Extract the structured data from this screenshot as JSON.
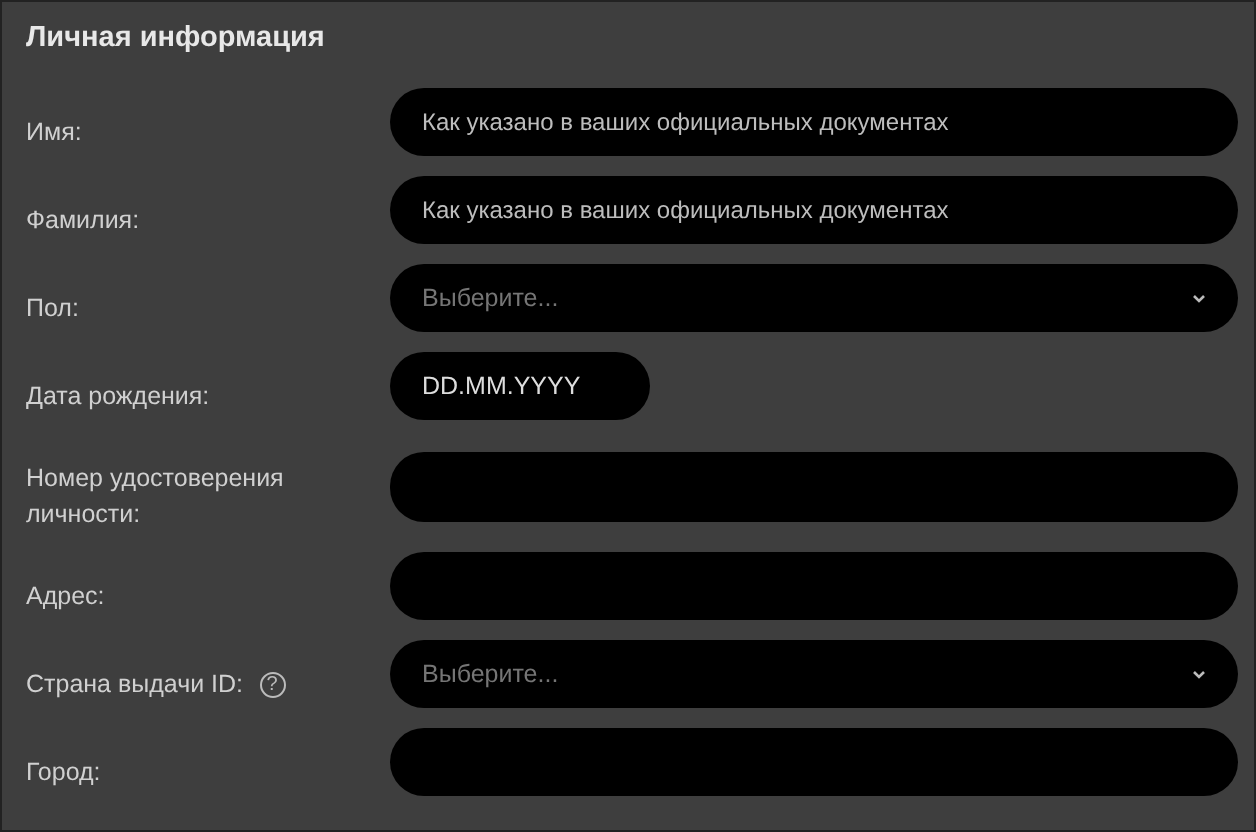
{
  "section": {
    "title": "Личная информация"
  },
  "fields": [
    {
      "label": "Имя:",
      "kind": "text",
      "placeholder": "Как указано в ваших официальных документах"
    },
    {
      "label": "Фамилия:",
      "kind": "text",
      "placeholder": "Как указано в ваших официальных документах"
    },
    {
      "label": "Пол:",
      "kind": "select",
      "placeholder": "Выберите..."
    },
    {
      "label": "Дата рождения:",
      "kind": "date",
      "value": "DD.MM.YYYY"
    },
    {
      "label": "Номер удостоверения личности:",
      "kind": "text"
    },
    {
      "label": "Адрес:",
      "kind": "text"
    },
    {
      "label": "Страна выдачи ID:",
      "kind": "select",
      "placeholder": "Выберите...",
      "help": "?"
    },
    {
      "label": "Город:",
      "kind": "text"
    }
  ]
}
